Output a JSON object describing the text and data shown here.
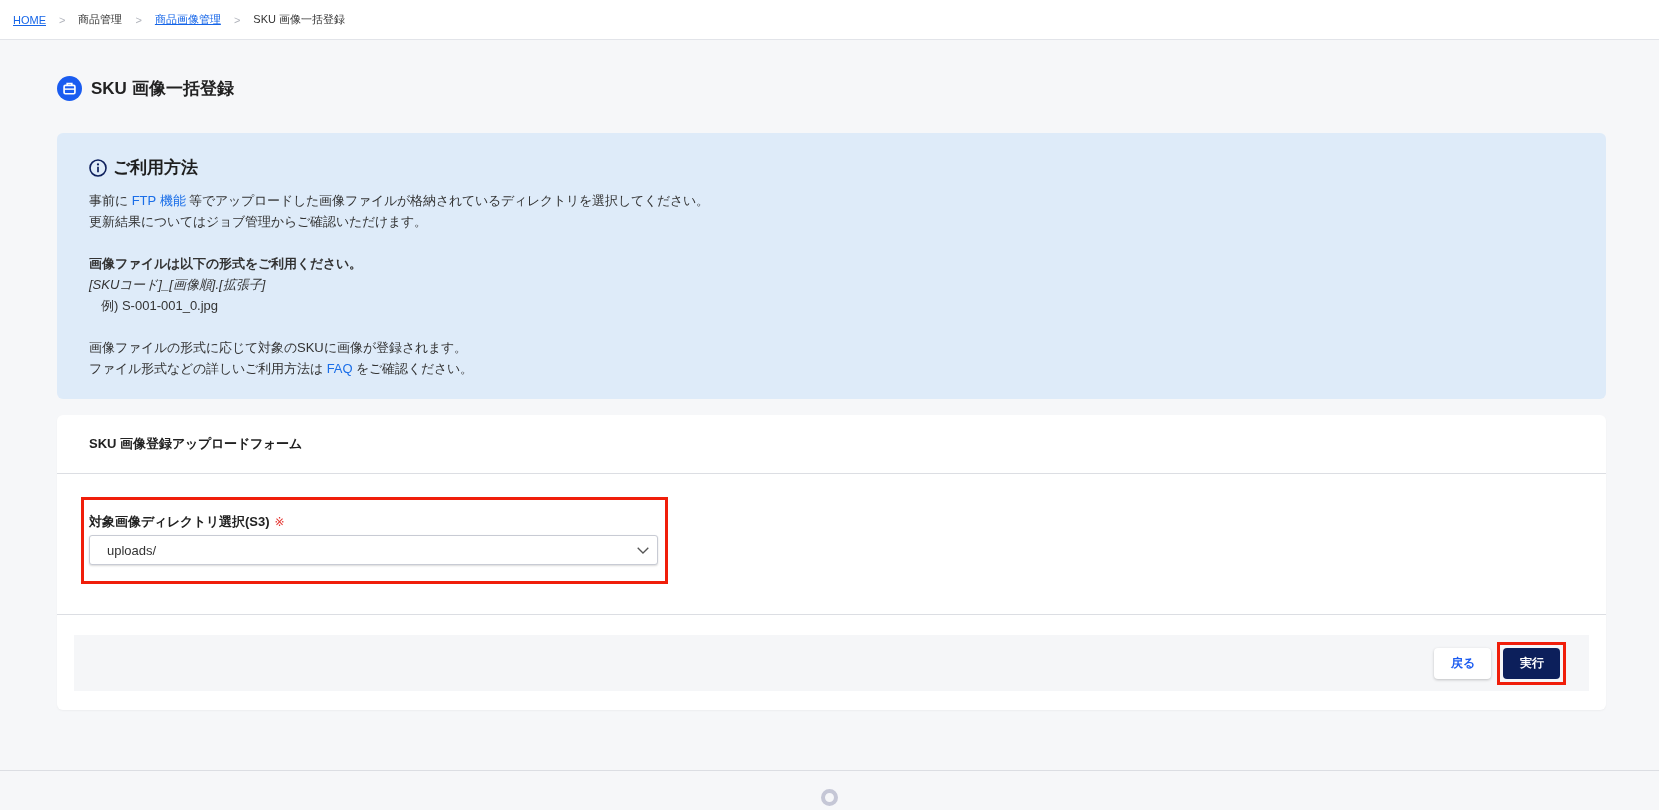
{
  "breadcrumb": [
    {
      "kind": "link",
      "label": "HOME"
    },
    {
      "kind": "separator",
      "label": ">"
    },
    {
      "kind": "text",
      "label": "商品管理"
    },
    {
      "kind": "separator",
      "label": ">"
    },
    {
      "kind": "link",
      "label": "商品画像管理"
    },
    {
      "kind": "separator",
      "label": ">"
    },
    {
      "kind": "text",
      "label": "SKU 画像一括登録"
    }
  ],
  "page": {
    "title": "SKU 画像一括登録"
  },
  "info": {
    "heading": "ご利用方法",
    "sections": [
      [
        {
          "kind": "plain",
          "parts": [
            {
              "kind": "text",
              "text": "事前に "
            },
            {
              "kind": "link",
              "text": "FTP 機能"
            },
            {
              "kind": "text",
              "text": " 等でアップロードした画像ファイルが格納されているディレクトリを選択してください。"
            }
          ]
        },
        {
          "kind": "plain",
          "parts": [
            {
              "kind": "text",
              "text": "更新結果についてはジョブ管理からご確認いただけます。"
            }
          ]
        }
      ],
      [
        {
          "kind": "bold",
          "parts": [
            {
              "kind": "text",
              "text": "画像ファイルは以下の形式をご利用ください。"
            }
          ]
        },
        {
          "kind": "pattern",
          "parts": [
            {
              "kind": "text",
              "text": "[SKUコード]_[画像順].[拡張子]"
            }
          ]
        },
        {
          "kind": "example",
          "parts": [
            {
              "kind": "text",
              "text": "例) S-001-001_0.jpg"
            }
          ]
        }
      ],
      [
        {
          "kind": "plain",
          "parts": [
            {
              "kind": "text",
              "text": "画像ファイルの形式に応じて対象のSKUに画像が登録されます。"
            }
          ]
        },
        {
          "kind": "plain",
          "parts": [
            {
              "kind": "text",
              "text": "ファイル形式などの詳しいご利用方法は "
            },
            {
              "kind": "link",
              "text": "FAQ"
            },
            {
              "kind": "text",
              "text": " をご確認ください。"
            }
          ]
        }
      ]
    ]
  },
  "form": {
    "title": "SKU 画像登録アップロードフォーム",
    "fields": [
      {
        "kind": "select",
        "label": "対象画像ディレクトリ選択(S3)",
        "required_mark": "※",
        "value": "uploads/",
        "highlighted": true
      }
    ],
    "buttons": [
      {
        "kind": "secondary",
        "label": "戻る",
        "highlighted": false
      },
      {
        "kind": "primary",
        "label": "実行",
        "highlighted": true
      }
    ]
  }
}
